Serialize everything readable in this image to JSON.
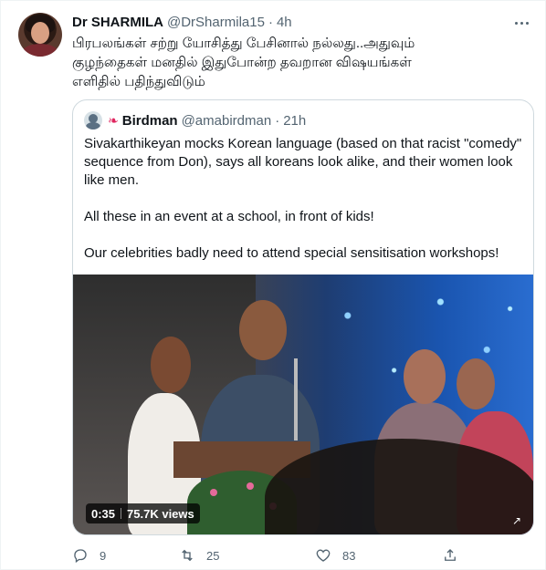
{
  "tweet": {
    "author_name": "Dr SHARMILA",
    "author_handle": "@DrSharmila15",
    "separator": "·",
    "time": "4h",
    "text_lines": [
      "பிரபலங்கள் சற்று யோசித்து பேசினால் நல்லது..அதுவும்",
      "குழந்தைகள் மனதில் இதுபோன்ற தவறான விஷயங்கள்",
      "எளிதில் பதிந்துவிடும்"
    ]
  },
  "quote": {
    "author_name": "Birdman",
    "author_handle": "@amabirdman",
    "separator": "·",
    "time": "21h",
    "paragraphs": [
      "Sivakarthikeyan mocks Korean language (based on that racist \"comedy\" sequence from Don), says all koreans look alike, and their women look like men.",
      "All these in an event at a school, in front of kids!",
      "Our celebrities badly need to attend special sensitisation workshops!"
    ],
    "video": {
      "duration": "0:35",
      "views": "75.7K views"
    }
  },
  "actions": {
    "reply_count": "9",
    "retweet_count": "25",
    "like_count": "83"
  },
  "icons": {
    "more": "more-icon",
    "bird": "bird-icon",
    "reply": "reply-icon",
    "retweet": "retweet-icon",
    "like": "heart-icon",
    "share": "share-icon"
  }
}
